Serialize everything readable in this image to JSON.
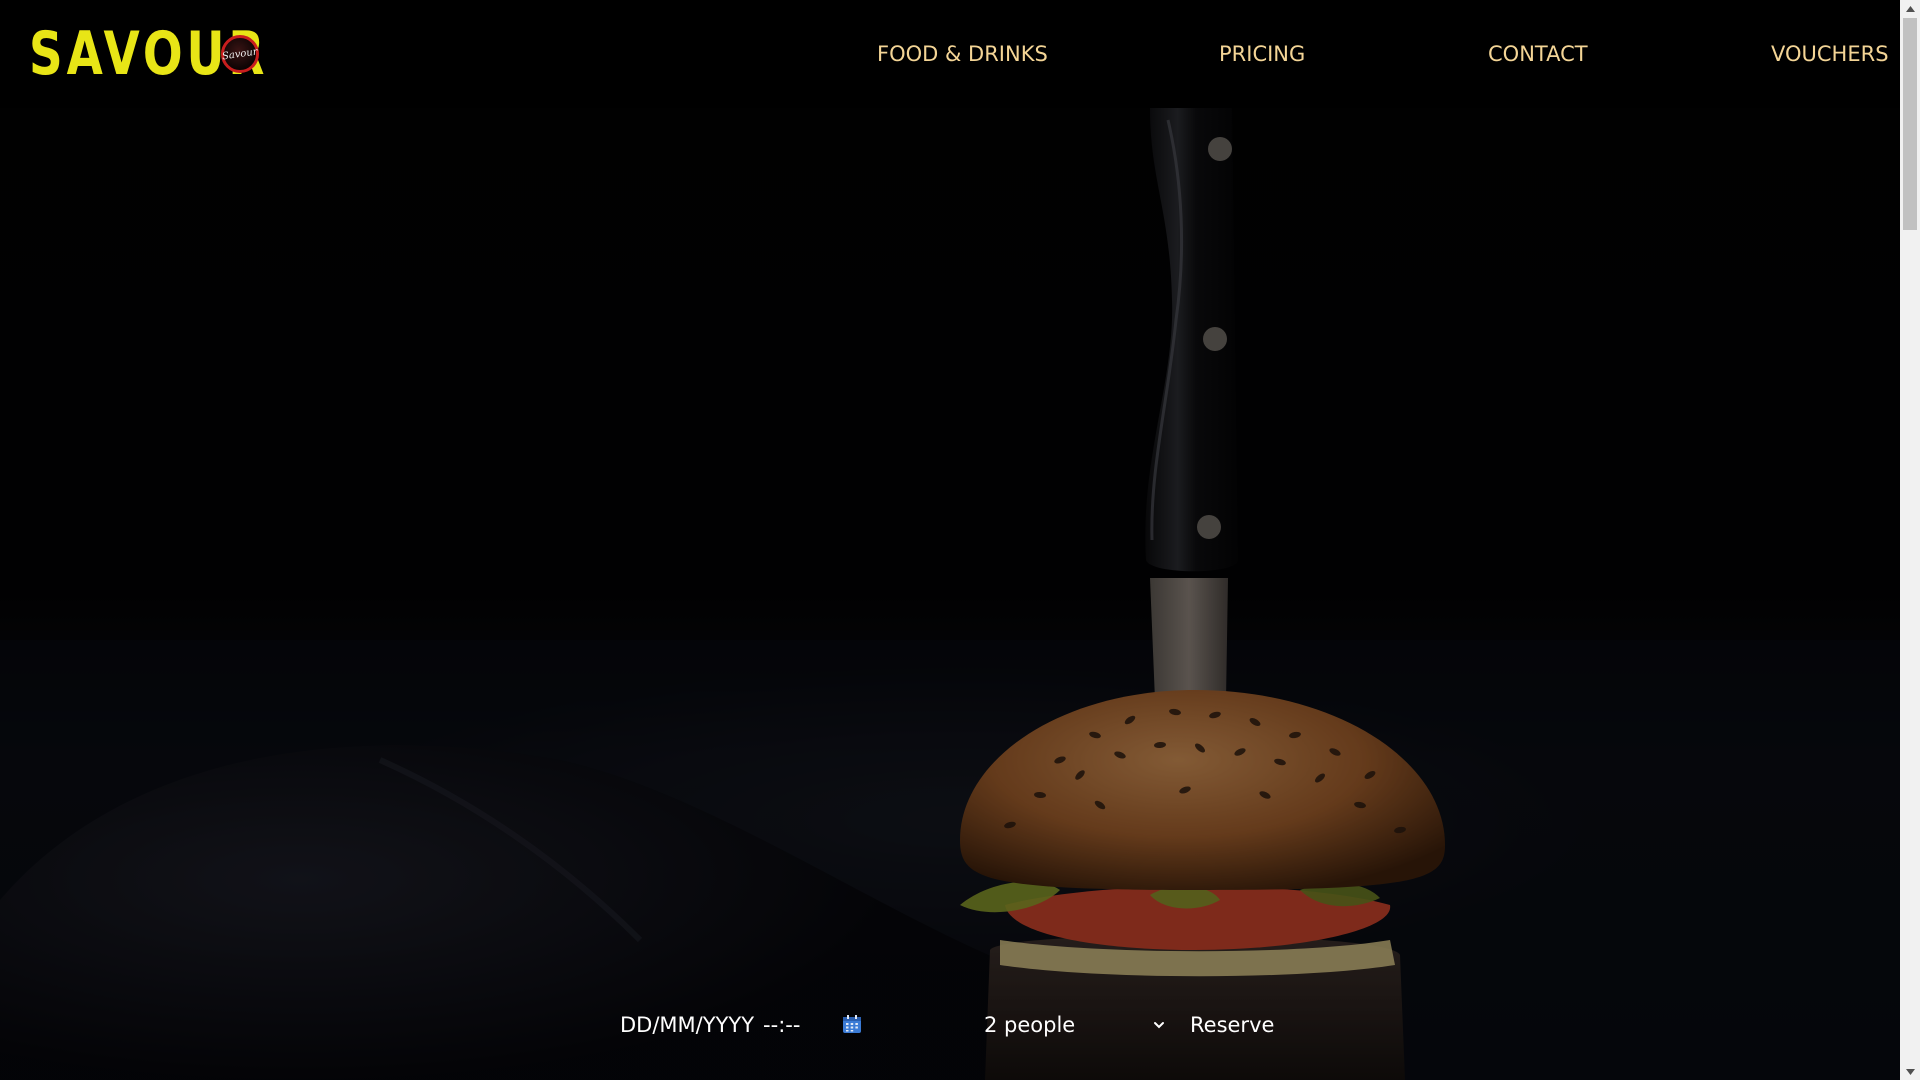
{
  "header": {
    "brand_name": "SAVOUR",
    "brand_badge_text": "Savour",
    "nav": {
      "food_drinks": "FOOD & DRINKS",
      "pricing": "PRICING",
      "contact": "CONTACT",
      "vouchers": "VOUCHERS"
    }
  },
  "hero": {
    "image_subject": "burger-with-knife"
  },
  "reservation": {
    "date_placeholder": "DD/MM/YYYY",
    "time_placeholder": "--:--",
    "calendar_icon": "calendar-icon",
    "party_size_selected": "2 people",
    "reserve_label": "Reserve"
  },
  "colors": {
    "brand_yellow": "#e8e516",
    "nav_text": "#f4d596",
    "badge_red": "#c81e1e",
    "background": "#000000",
    "form_text": "#ffffff"
  }
}
